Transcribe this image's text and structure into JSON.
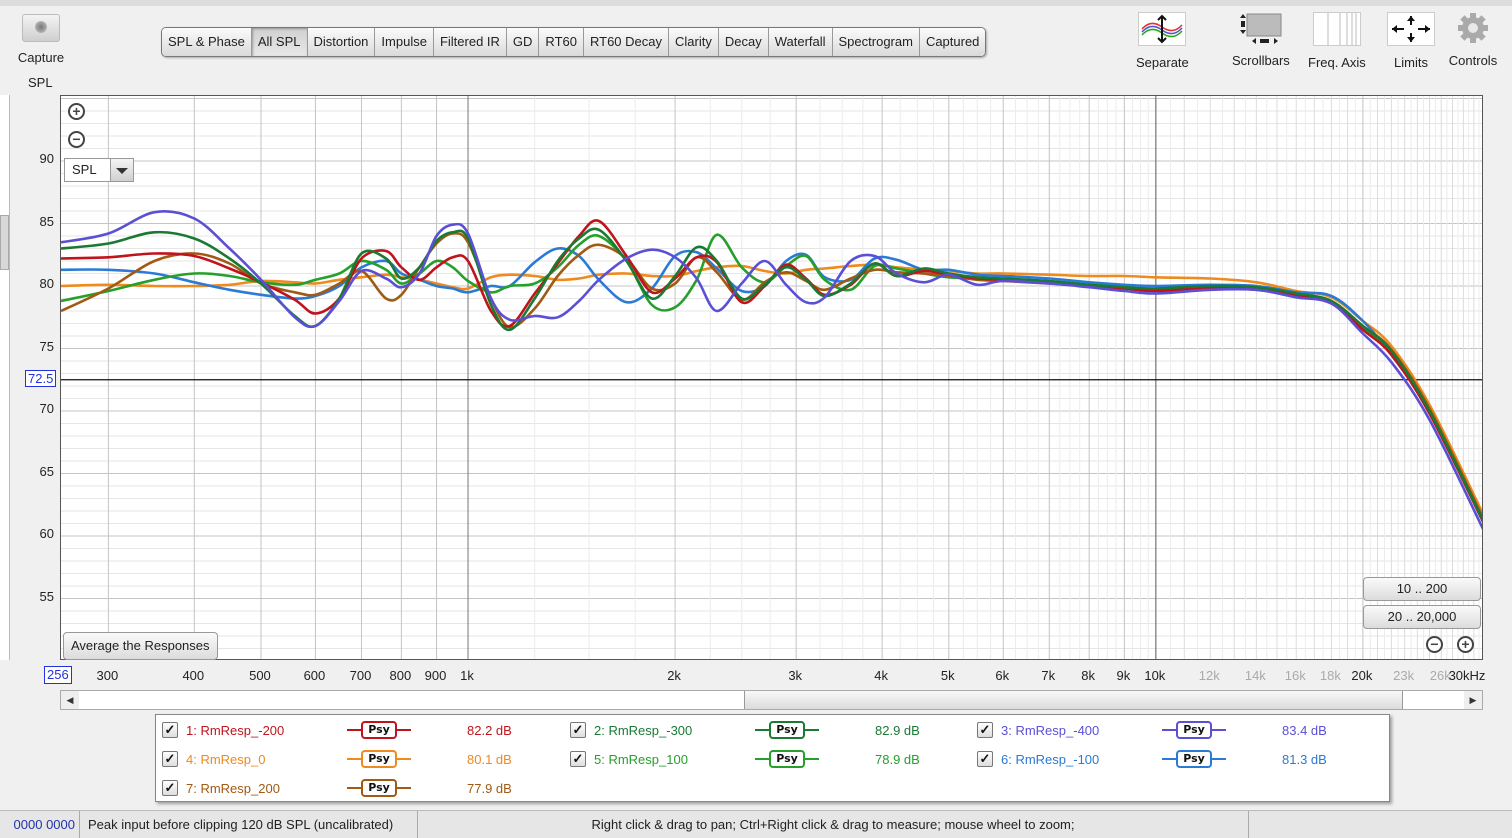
{
  "capture": {
    "label": "Capture",
    "icon": "camera-icon"
  },
  "graph_label": "SPL",
  "tabs": [
    "SPL & Phase",
    "All SPL",
    "Distortion",
    "Impulse",
    "Filtered IR",
    "GD",
    "RT60",
    "RT60 Decay",
    "Clarity",
    "Decay",
    "Waterfall",
    "Spectrogram",
    "Captured"
  ],
  "active_tab": "All SPL",
  "toolbar": [
    {
      "label": "Separate",
      "icon": "separate-traces-icon"
    },
    {
      "label": "Scrollbars",
      "icon": "scrollbars-icon"
    },
    {
      "label": "Freq. Axis",
      "icon": "freq-axis-icon"
    },
    {
      "label": "Limits",
      "icon": "limits-icon"
    },
    {
      "label": "Controls",
      "icon": "gear-icon"
    }
  ],
  "plot_controls": {
    "display_select": "SPL",
    "average_button": "Average the Responses",
    "range_buttons": [
      "10 .. 200",
      "20 .. 20,000"
    ],
    "y_cursor_value": "72.5",
    "x_cursor_value": "256"
  },
  "legend": [
    {
      "id": 1,
      "name": "1: RmResp_-200",
      "smoothing": "Psy",
      "level": "82.2 dB",
      "color": "#c0141c",
      "checked": true
    },
    {
      "id": 2,
      "name": "2: RmResp_-300",
      "smoothing": "Psy",
      "level": "82.9 dB",
      "color": "#1a7a34",
      "checked": true
    },
    {
      "id": 3,
      "name": "3: RmResp_-400",
      "smoothing": "Psy",
      "level": "83.4 dB",
      "color": "#5b4fd6",
      "checked": true
    },
    {
      "id": 4,
      "name": "4: RmResp_0",
      "smoothing": "Psy",
      "level": "80.1 dB",
      "color": "#ee8a1e",
      "checked": true
    },
    {
      "id": 5,
      "name": "5: RmResp_100",
      "smoothing": "Psy",
      "level": "78.9 dB",
      "color": "#25a02a",
      "checked": true
    },
    {
      "id": 6,
      "name": "6: RmResp_-100",
      "smoothing": "Psy",
      "level": "81.3 dB",
      "color": "#2a7ad6",
      "checked": true
    },
    {
      "id": 7,
      "name": "7: RmResp_200",
      "smoothing": "Psy",
      "level": "77.9 dB",
      "color": "#a05a14",
      "checked": true
    }
  ],
  "status": {
    "left": "0000 0000",
    "peak": "Peak input before clipping 120 dB SPL (uncalibrated)",
    "hint": "Right click & drag to pan; Ctrl+Right click & drag to measure; mouse wheel to zoom;"
  },
  "chart_data": {
    "type": "line",
    "title": "All SPL",
    "xlabel": "Hz",
    "ylabel": "SPL",
    "x_scale": "log",
    "xlim": [
      256,
      30000
    ],
    "ylim": [
      50,
      95.2
    ],
    "y_reference_line": 72.5,
    "grid": true,
    "y_ticks": [
      90,
      85,
      80,
      75,
      70,
      65,
      60,
      55
    ],
    "x_ticks": [
      {
        "v": 300,
        "label": "300",
        "major": true
      },
      {
        "v": 400,
        "label": "400",
        "major": true
      },
      {
        "v": 500,
        "label": "500",
        "major": true
      },
      {
        "v": 600,
        "label": "600",
        "major": true
      },
      {
        "v": 700,
        "label": "700",
        "major": true
      },
      {
        "v": 800,
        "label": "800",
        "major": true
      },
      {
        "v": 900,
        "label": "900",
        "major": true
      },
      {
        "v": 1000,
        "label": "1k",
        "major": true
      },
      {
        "v": 2000,
        "label": "2k",
        "major": true
      },
      {
        "v": 3000,
        "label": "3k",
        "major": true
      },
      {
        "v": 4000,
        "label": "4k",
        "major": true
      },
      {
        "v": 5000,
        "label": "5k",
        "major": true
      },
      {
        "v": 6000,
        "label": "6k",
        "major": true
      },
      {
        "v": 7000,
        "label": "7k",
        "major": true
      },
      {
        "v": 8000,
        "label": "8k",
        "major": true
      },
      {
        "v": 9000,
        "label": "9k",
        "major": true
      },
      {
        "v": 10000,
        "label": "10k",
        "major": true
      },
      {
        "v": 12000,
        "label": "12k",
        "major": false
      },
      {
        "v": 14000,
        "label": "14k",
        "major": false
      },
      {
        "v": 16000,
        "label": "16k",
        "major": false
      },
      {
        "v": 18000,
        "label": "18k",
        "major": false
      },
      {
        "v": 20000,
        "label": "20k",
        "major": true
      },
      {
        "v": 23000,
        "label": "23k",
        "major": false
      },
      {
        "v": 26000,
        "label": "26k",
        "major": false
      },
      {
        "v": 30000,
        "label": "30kHz",
        "major": true
      }
    ],
    "x": [
      256,
      300,
      350,
      400,
      450,
      500,
      560,
      600,
      650,
      700,
      760,
      800,
      850,
      900,
      950,
      1000,
      1080,
      1150,
      1250,
      1350,
      1450,
      1550,
      1700,
      1850,
      2000,
      2150,
      2300,
      2500,
      2700,
      2900,
      3100,
      3300,
      3600,
      3900,
      4200,
      4600,
      5000,
      5500,
      6000,
      7000,
      8000,
      9000,
      10000,
      12000,
      14000,
      16000,
      18000,
      20000,
      22000,
      25000,
      30000
    ],
    "series": [
      {
        "name": "1: RmResp_-200",
        "values": [
          82.2,
          82.3,
          82.6,
          82.4,
          81.4,
          80.3,
          78.9,
          77.8,
          79.0,
          82.2,
          82.8,
          81.5,
          80.5,
          81.5,
          82.3,
          82.0,
          78.0,
          76.8,
          79.4,
          81.8,
          84.0,
          85.2,
          82.4,
          79.5,
          80.6,
          82.3,
          81.9,
          78.7,
          80.0,
          81.7,
          80.6,
          79.3,
          80.1,
          81.8,
          80.8,
          81.2,
          80.9,
          80.6,
          80.5,
          80.3,
          80.0,
          79.8,
          79.6,
          79.9,
          79.8,
          79.2,
          78.6,
          76.5,
          74.5,
          69.8,
          61.0
        ]
      },
      {
        "name": "2: RmResp_-300",
        "values": [
          83.0,
          83.4,
          84.3,
          83.8,
          82.2,
          80.2,
          77.6,
          76.8,
          79.0,
          82.6,
          82.2,
          80.6,
          81.5,
          83.6,
          84.3,
          83.8,
          78.5,
          76.5,
          79.0,
          82.0,
          83.8,
          84.5,
          82.0,
          79.0,
          80.8,
          83.1,
          82.0,
          79.0,
          80.1,
          81.5,
          80.5,
          79.2,
          80.2,
          81.8,
          80.8,
          81.4,
          81.0,
          80.7,
          80.6,
          80.4,
          80.1,
          79.9,
          79.8,
          80.0,
          79.9,
          79.4,
          78.8,
          76.8,
          74.8,
          70.0,
          61.1
        ]
      },
      {
        "name": "3: RmResp_-400",
        "values": [
          83.5,
          84.2,
          85.9,
          85.4,
          83.0,
          80.5,
          77.5,
          76.8,
          78.8,
          81.2,
          80.6,
          79.9,
          81.0,
          84.0,
          84.9,
          84.2,
          79.0,
          77.3,
          77.6,
          77.5,
          78.8,
          80.5,
          82.2,
          82.9,
          82.3,
          80.6,
          78.0,
          80.2,
          82.0,
          80.1,
          78.7,
          79.1,
          82.0,
          82.4,
          81.0,
          80.3,
          80.9,
          80.1,
          80.4,
          80.2,
          79.9,
          79.6,
          79.4,
          79.7,
          79.7,
          79.1,
          78.6,
          76.2,
          73.9,
          69.3,
          60.4
        ]
      },
      {
        "name": "4: RmResp_0",
        "values": [
          80.0,
          80.1,
          80.0,
          80.0,
          80.1,
          80.4,
          80.3,
          80.2,
          80.5,
          80.7,
          80.9,
          80.7,
          80.5,
          80.2,
          79.9,
          79.8,
          80.7,
          80.9,
          80.8,
          80.5,
          80.6,
          80.9,
          81.0,
          80.8,
          80.8,
          81.2,
          81.5,
          81.6,
          81.2,
          81.0,
          81.3,
          81.4,
          81.6,
          81.7,
          81.5,
          81.3,
          81.2,
          81.0,
          81.0,
          80.9,
          80.8,
          80.8,
          80.7,
          80.6,
          80.3,
          79.6,
          79.1,
          77.2,
          75.2,
          70.5,
          61.6
        ]
      },
      {
        "name": "5: RmResp_100",
        "values": [
          78.8,
          79.6,
          80.5,
          81.0,
          80.8,
          80.3,
          80.1,
          80.5,
          81.0,
          82.0,
          81.3,
          80.2,
          81.0,
          82.0,
          81.5,
          80.4,
          79.5,
          80.0,
          80.2,
          81.5,
          83.3,
          84.0,
          82.0,
          78.5,
          78.3,
          80.5,
          84.1,
          81.5,
          80.3,
          81.6,
          82.4,
          80.5,
          79.7,
          81.6,
          81.4,
          81.0,
          80.7,
          80.6,
          80.5,
          80.3,
          80.1,
          79.9,
          79.7,
          79.9,
          79.8,
          79.3,
          78.8,
          76.6,
          74.6,
          69.9,
          61.0
        ]
      },
      {
        "name": "6: RmResp_-100",
        "values": [
          81.3,
          81.3,
          81.0,
          80.3,
          79.7,
          79.3,
          79.0,
          79.2,
          80.0,
          81.5,
          82.0,
          81.0,
          80.5,
          80.0,
          79.8,
          79.5,
          80.0,
          80.0,
          81.9,
          83.0,
          82.4,
          80.5,
          78.7,
          79.8,
          82.4,
          82.7,
          81.4,
          79.6,
          80.0,
          82.0,
          82.5,
          80.7,
          80.5,
          82.2,
          82.1,
          81.3,
          81.3,
          80.9,
          80.8,
          80.6,
          80.3,
          80.1,
          80.0,
          80.1,
          80.0,
          79.5,
          79.2,
          77.2,
          74.5,
          69.9,
          61.0
        ]
      },
      {
        "name": "7: RmResp_200",
        "values": [
          78.0,
          79.8,
          82.0,
          82.6,
          81.8,
          80.2,
          79.5,
          79.3,
          80.2,
          81.2,
          79.0,
          79.3,
          81.5,
          83.4,
          84.2,
          83.5,
          79.0,
          76.7,
          78.2,
          80.8,
          82.5,
          83.3,
          82.2,
          79.8,
          80.2,
          82.3,
          81.1,
          78.9,
          80.3,
          81.1,
          80.4,
          79.7,
          80.6,
          81.3,
          81.1,
          81.0,
          80.8,
          80.5,
          80.4,
          80.2,
          80.0,
          79.8,
          79.6,
          79.8,
          79.7,
          79.2,
          78.7,
          76.8,
          74.9,
          70.2,
          61.3
        ]
      }
    ]
  }
}
